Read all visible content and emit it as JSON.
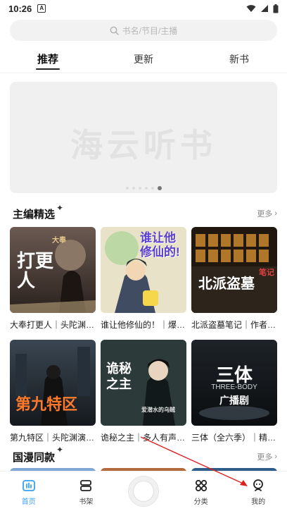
{
  "status_bar": {
    "time": "10:26",
    "a_badge": "A"
  },
  "search": {
    "placeholder": "书名/节目/主播"
  },
  "tabs": [
    {
      "label": "推荐",
      "active": true
    },
    {
      "label": "更新",
      "active": false
    },
    {
      "label": "新书",
      "active": false
    }
  ],
  "banner": {
    "text": "海云听书",
    "dots": 6,
    "active_dot": 5
  },
  "section_editor": {
    "title": "主编精选",
    "more": "更多"
  },
  "section_anime": {
    "title": "国漫同款",
    "more": "更多"
  },
  "books": [
    {
      "title": "大奉打更人｜头陀渊…",
      "cover_text": "打更人",
      "cover_small": "大奉"
    },
    {
      "title": "谁让他修仙的！｜爆…",
      "cover_text": "谁让他修仙的!",
      "cover_small": ""
    },
    {
      "title": "北派盗墓笔记｜作者…",
      "cover_text": "北派盗墓",
      "cover_small": "笔记"
    },
    {
      "title": "第九特区｜头陀渊演…",
      "cover_text": "第九特区",
      "cover_small": ""
    },
    {
      "title": "诡秘之主｜多人有声剧…",
      "cover_text": "诡秘之主",
      "cover_small": "爱潜水的乌贼"
    },
    {
      "title": "三体（全六季）｜精品…",
      "cover_text": "三体",
      "cover_small": "THREE-BODY",
      "cover_sub": "广播剧"
    }
  ],
  "bottom_nav": [
    {
      "label": "首页",
      "icon": "home-icon",
      "active": true
    },
    {
      "label": "书架",
      "icon": "bookshelf-icon",
      "active": false
    },
    {
      "label": "",
      "icon": "play-icon",
      "active": false
    },
    {
      "label": "分类",
      "icon": "category-icon",
      "active": false
    },
    {
      "label": "我的",
      "icon": "profile-icon",
      "active": false
    }
  ],
  "colors": {
    "accent": "#39a0f5",
    "highlight": "#bfe3ff",
    "annotation": "#e02020"
  }
}
